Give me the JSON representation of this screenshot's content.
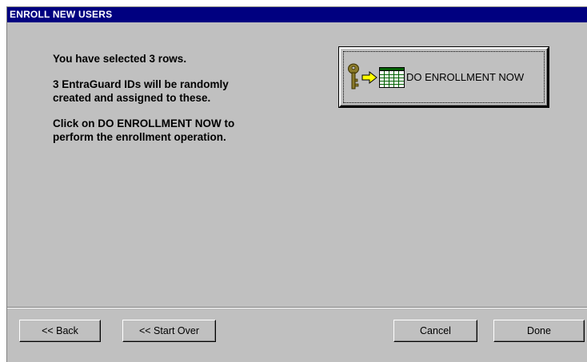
{
  "window": {
    "title": "ENROLL NEW USERS"
  },
  "message": {
    "selected": "You have selected 3 rows.",
    "ids_line1": "3 EntraGuard IDs will be randomly",
    "ids_line2": "created and assigned to these.",
    "click_line1": "Click on DO ENROLLMENT NOW to",
    "click_line2": "perform the enrollment operation."
  },
  "enroll_button": {
    "label": "DO ENROLLMENT NOW",
    "icons": [
      "key-icon",
      "arrow-right-icon",
      "grid-table-icon"
    ]
  },
  "footer": {
    "back_label": "<< Back",
    "start_over_label": "<< Start Over",
    "cancel_label": "Cancel",
    "done_label": "Done"
  }
}
